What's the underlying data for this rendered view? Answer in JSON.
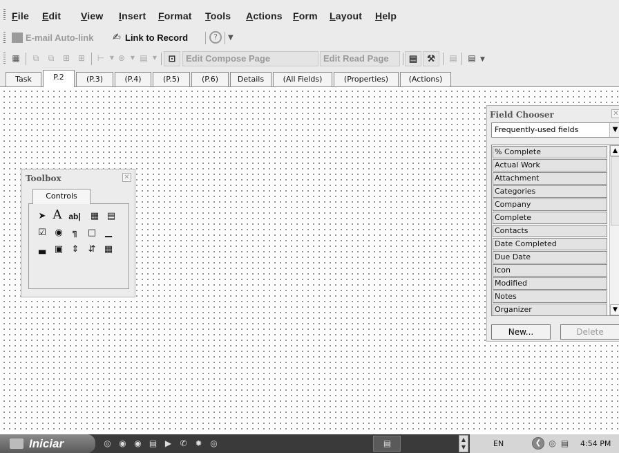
{
  "menubar": {
    "items": [
      "File",
      "Edit",
      "View",
      "Insert",
      "Format",
      "Tools",
      "Actions",
      "Form",
      "Layout",
      "Help"
    ]
  },
  "toolbar1": {
    "email_autolink": "E-mail Auto-link",
    "link_to_record": "Link to Record"
  },
  "toolbar2": {
    "edit_compose": "Edit Compose Page",
    "edit_read": "Edit Read Page"
  },
  "tabs": [
    "Task",
    "P.2",
    "(P.3)",
    "(P.4)",
    "(P.5)",
    "(P.6)",
    "Details",
    "(All Fields)",
    "(Properties)",
    "(Actions)"
  ],
  "active_tab": "P.2",
  "toolbox": {
    "title": "Toolbox",
    "tab": "Controls"
  },
  "field_chooser": {
    "title": "Field Chooser",
    "selected_set": "Frequently-used fields",
    "fields": [
      "% Complete",
      "Actual Work",
      "Attachment",
      "Categories",
      "Company",
      "Complete",
      "Contacts",
      "Date Completed",
      "Due Date",
      "Icon",
      "Modified",
      "Notes",
      "Organizer"
    ],
    "new_label": "New...",
    "delete_label": "Delete"
  },
  "taskbar": {
    "start_label": "Iniciar",
    "language": "EN",
    "clock": "4:54 PM"
  }
}
